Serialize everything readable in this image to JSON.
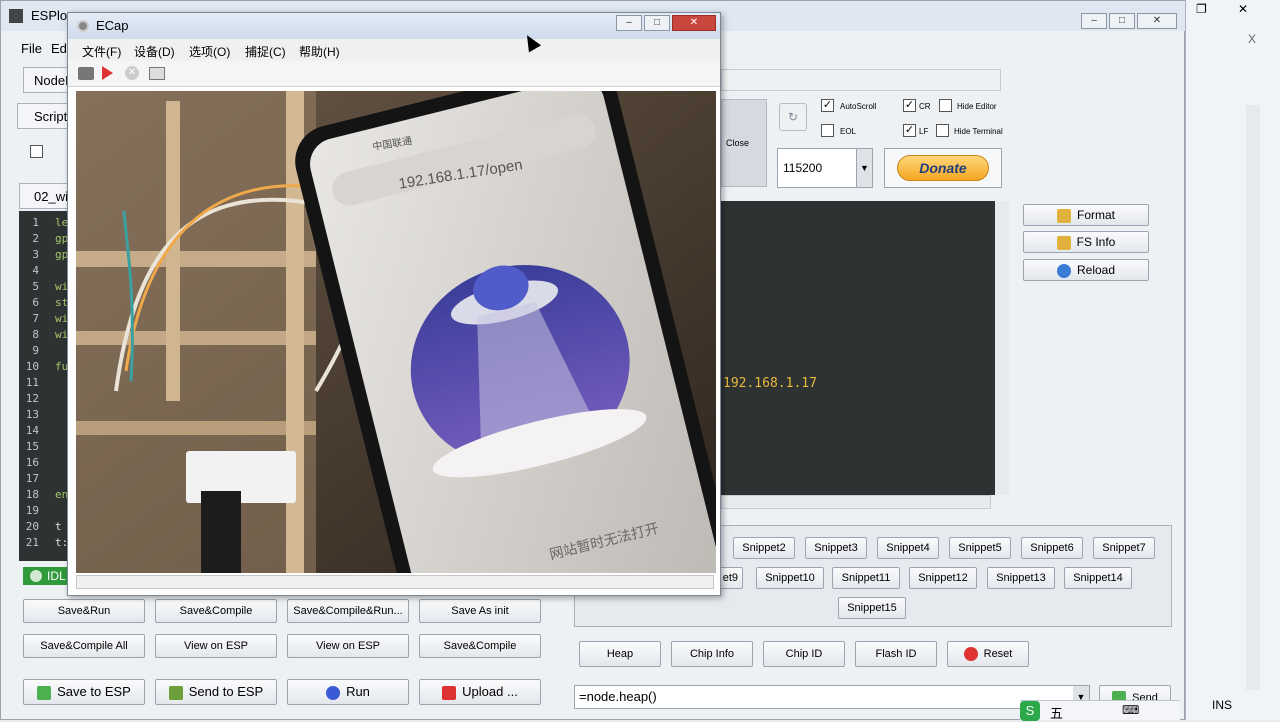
{
  "esplorer": {
    "title": "ESPlorer",
    "menu": [
      "File",
      "Ed"
    ],
    "tabs": {
      "nodemcu": "NodeM",
      "scripts": "Script",
      "file": "02_wi"
    },
    "editor": {
      "line_numbers": [
        "1",
        "2",
        "3",
        "4",
        "5",
        "6",
        "7",
        "8",
        "9",
        "10",
        "11",
        "12",
        "13",
        "14",
        "15",
        "16",
        "17",
        "18",
        "19",
        "20",
        "21"
      ],
      "code_fragments": [
        "le",
        "gp",
        "gp",
        "wi",
        "st",
        "wi",
        "wi",
        "fu",
        "en",
        "t",
        "t:"
      ]
    },
    "status": "IDL",
    "buttons_row1": [
      "Save&Run",
      "Save&Compile",
      "Save&Compile&Run...",
      "Save As init"
    ],
    "buttons_row2": [
      "Save&Compile All",
      "View on ESP",
      "View on ESP",
      "Save&Compile"
    ],
    "buttons_row3": [
      "Save to ESP",
      "Send to ESP",
      "Run",
      "Upload ..."
    ],
    "serial": {
      "close_label": "Close",
      "baud": "115200",
      "donate": "Donate",
      "options": [
        {
          "label": "AutoScroll",
          "checked": true
        },
        {
          "label": "CR",
          "checked": true
        },
        {
          "label": "Hide Editor",
          "checked": false
        },
        {
          "label": "EOL",
          "checked": false
        },
        {
          "label": "LF",
          "checked": true
        },
        {
          "label": "Hide Terminal",
          "checked": false
        }
      ]
    },
    "terminal_ip": "192.168.1.17",
    "side_buttons": [
      "Format",
      "FS Info",
      "Reload"
    ],
    "snippets_row1": [
      "Snippet2",
      "Snippet3",
      "Snippet4",
      "Snippet5",
      "Snippet6",
      "Snippet7"
    ],
    "snippets_row2": [
      "et9",
      "Snippet10",
      "Snippet11",
      "Snippet12",
      "Snippet13",
      "Snippet14"
    ],
    "snippets_row3": [
      "Snippet15"
    ],
    "bottom_buttons": [
      "Heap",
      "Chip Info",
      "Chip ID",
      "Flash ID",
      "Reset"
    ],
    "command": "=node.heap()",
    "send": "Send",
    "ins": "INS"
  },
  "ecap": {
    "title": "ECap",
    "menu": [
      "文件(F)",
      "设备(D)",
      "选项(O)",
      "捕捉(C)",
      "帮助(H)"
    ],
    "phone": {
      "carrier": "中国联通",
      "url": "192.168.1.17/open",
      "footer_text": "网站暂时无法打开"
    }
  },
  "colors": {
    "terminal_bg": "#2e3233",
    "terminal_text": "#e8b83a",
    "donate": "#f5a623",
    "idle": "#2e9a3a",
    "titlebar": "#dfe7f2"
  }
}
